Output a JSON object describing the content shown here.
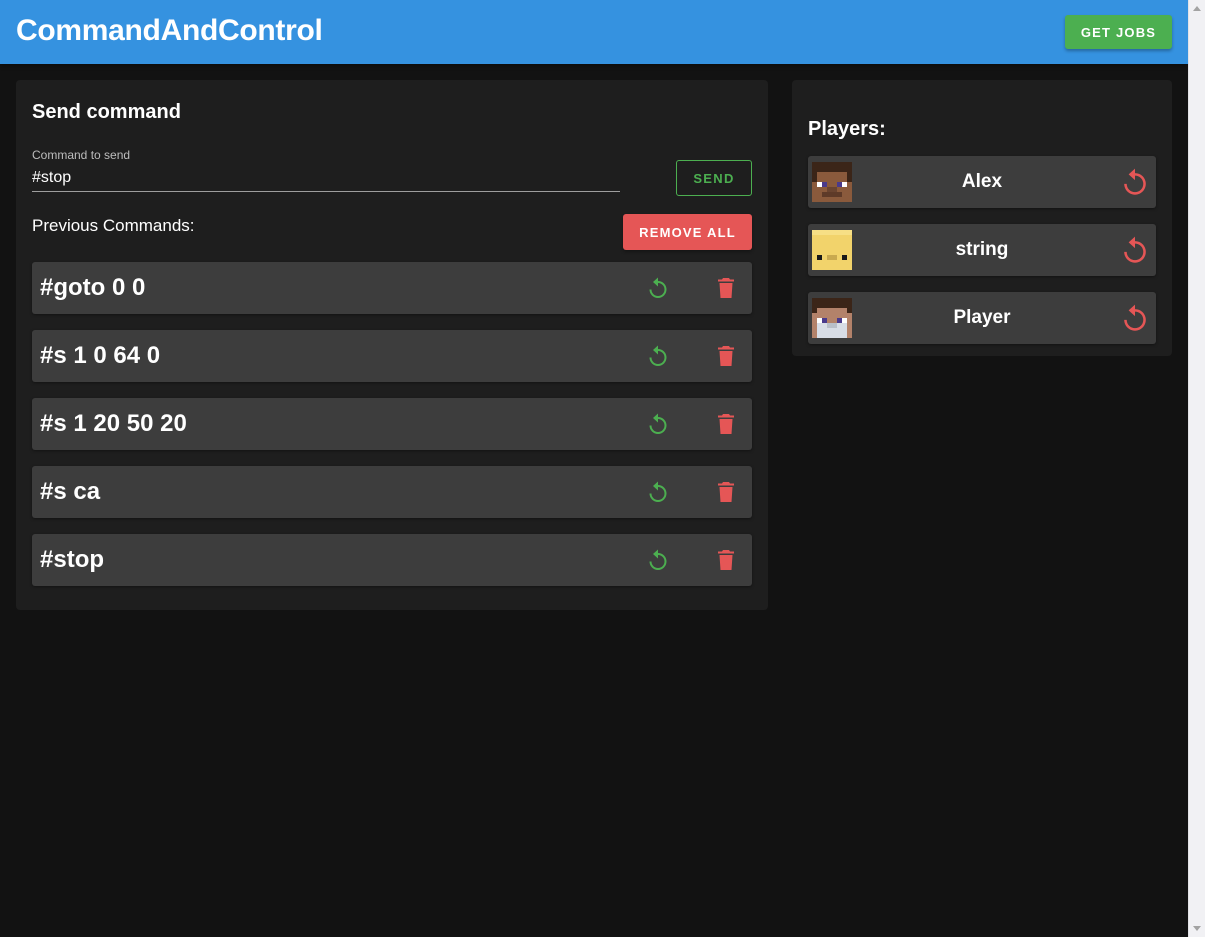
{
  "app": {
    "title": "CommandAndControl",
    "get_jobs_label": "GET JOBS"
  },
  "send_command": {
    "title": "Send command",
    "input_label": "Command to send",
    "input_value": "#stop",
    "send_label": "SEND",
    "previous_label": "Previous Commands:",
    "remove_all_label": "REMOVE ALL"
  },
  "previous_commands": [
    {
      "text": "#goto 0 0"
    },
    {
      "text": "#s 1 0 64 0"
    },
    {
      "text": "#s 1 20 50 20"
    },
    {
      "text": "#s ca"
    },
    {
      "text": "#stop"
    }
  ],
  "players": {
    "title": "Players:",
    "items": [
      {
        "name": "Alex",
        "avatar": "alex-avatar"
      },
      {
        "name": "string",
        "avatar": "string-avatar"
      },
      {
        "name": "Player",
        "avatar": "player-avatar"
      }
    ]
  },
  "colors": {
    "header": "#3592e0",
    "success": "#4caf50",
    "danger": "#e55656",
    "background": "#121212",
    "card": "#1e1e1e",
    "item": "#3d3d3d"
  },
  "icons": {
    "rerun": "rotate-left-icon",
    "delete": "trash-icon",
    "reset": "restart-icon"
  }
}
